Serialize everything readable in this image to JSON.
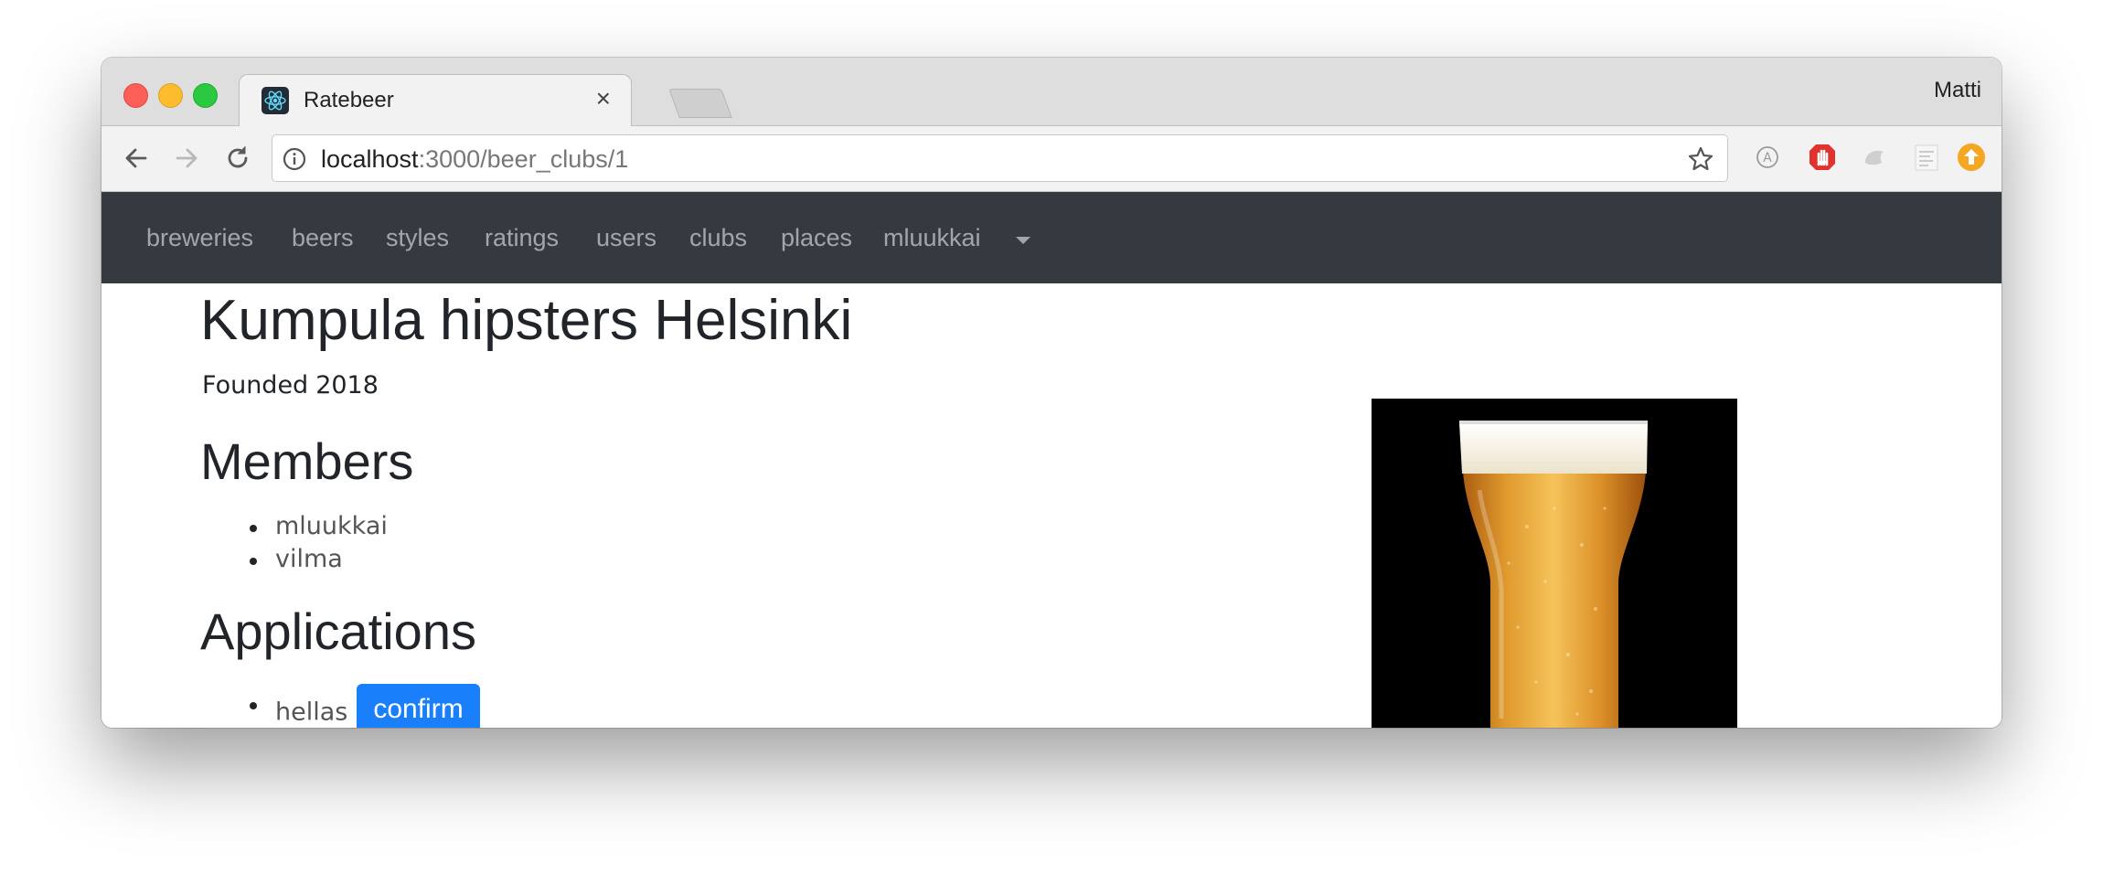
{
  "browser": {
    "tab_title": "Ratebeer",
    "tab_close": "×",
    "profile_name": "Matti",
    "url_host": "localhost",
    "url_rest": ":3000/beer_clubs/1"
  },
  "navbar": {
    "items": [
      "breweries",
      "beers",
      "styles",
      "ratings",
      "users",
      "clubs",
      "places"
    ],
    "user_menu": "mluukkai"
  },
  "club": {
    "name": "Kumpula hipsters Helsinki",
    "founded_label": "Founded",
    "founded_year": "2018",
    "members_heading": "Members",
    "members": [
      "mluukkai",
      "vilma"
    ],
    "applications_heading": "Applications",
    "applications": [
      "hellas"
    ],
    "confirm_label": "confirm"
  },
  "colors": {
    "navbar_bg": "#343a40",
    "confirm_bg": "#1a7ffb"
  }
}
